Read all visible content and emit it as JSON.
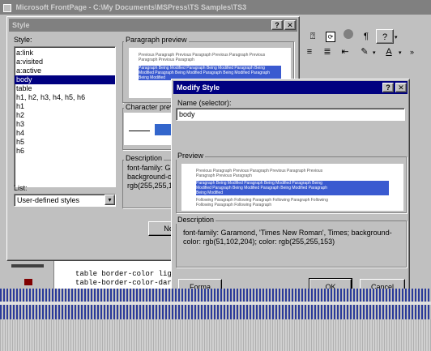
{
  "app": {
    "title": "Microsoft FrontPage - C:\\My Documents\\MSPress\\TS Samples\\TS3"
  },
  "toolbar": {
    "buttons": [
      "help-icon",
      "stop-icon",
      "paragraph-icon",
      "question-icon",
      "highlight-icon",
      "font-color-icon"
    ]
  },
  "editor": {
    "lines": [
      "table border-color lig",
      "table-border-color-dar"
    ]
  },
  "style_dialog": {
    "title": "Style",
    "styles_label": "Style:",
    "styles": [
      "a:link",
      "a:visited",
      "a:active",
      "body",
      "table",
      "h1, h2, h3, h4, h5, h6",
      "h1",
      "h2",
      "h3",
      "h4",
      "h5",
      "h6"
    ],
    "selected_style": "body",
    "paragraph_preview_label": "Paragraph preview",
    "character_preview_label": "Character prev",
    "description_label": "Description",
    "description_lines": [
      "font-family: Gar",
      "background-colo",
      "rgb(255,255,15"
    ],
    "list_label": "List:",
    "list_value": "User-defined styles",
    "new_button": "Ne"
  },
  "modify_dialog": {
    "title": "Modify Style",
    "name_label": "Name (selector):",
    "name_value": "body",
    "preview_label": "Preview",
    "preview_lines": {
      "before": [
        "Previous Paragraph Previous Paragraph Previous Paragraph Previous",
        "Paragraph Previous Paragraph"
      ],
      "selected": [
        "Paragraph Being Modified Paragraph Being Modified Paragraph Being",
        "Modified Paragraph Being Modified Paragraph Being Modified Paragraph",
        "Being Modified"
      ],
      "after": [
        "Following Paragraph Following Paragraph Following Paragraph Following",
        "Following Paragraph Following Paragraph"
      ]
    },
    "description_label": "Description",
    "description": "font-family: Garamond, 'Times New Roman', Times; background-color: rgb(51,102,204); color: rgb(255,255,153)",
    "format_button": "Forma",
    "ok_button": "OK",
    "cancel_button": "Cancel"
  },
  "colors": {
    "title_active": "#000080",
    "title_inactive": "#808080",
    "selection": "#000080",
    "preview_highlight": "#3a5ad0",
    "char_swatch": "#3366cc"
  }
}
